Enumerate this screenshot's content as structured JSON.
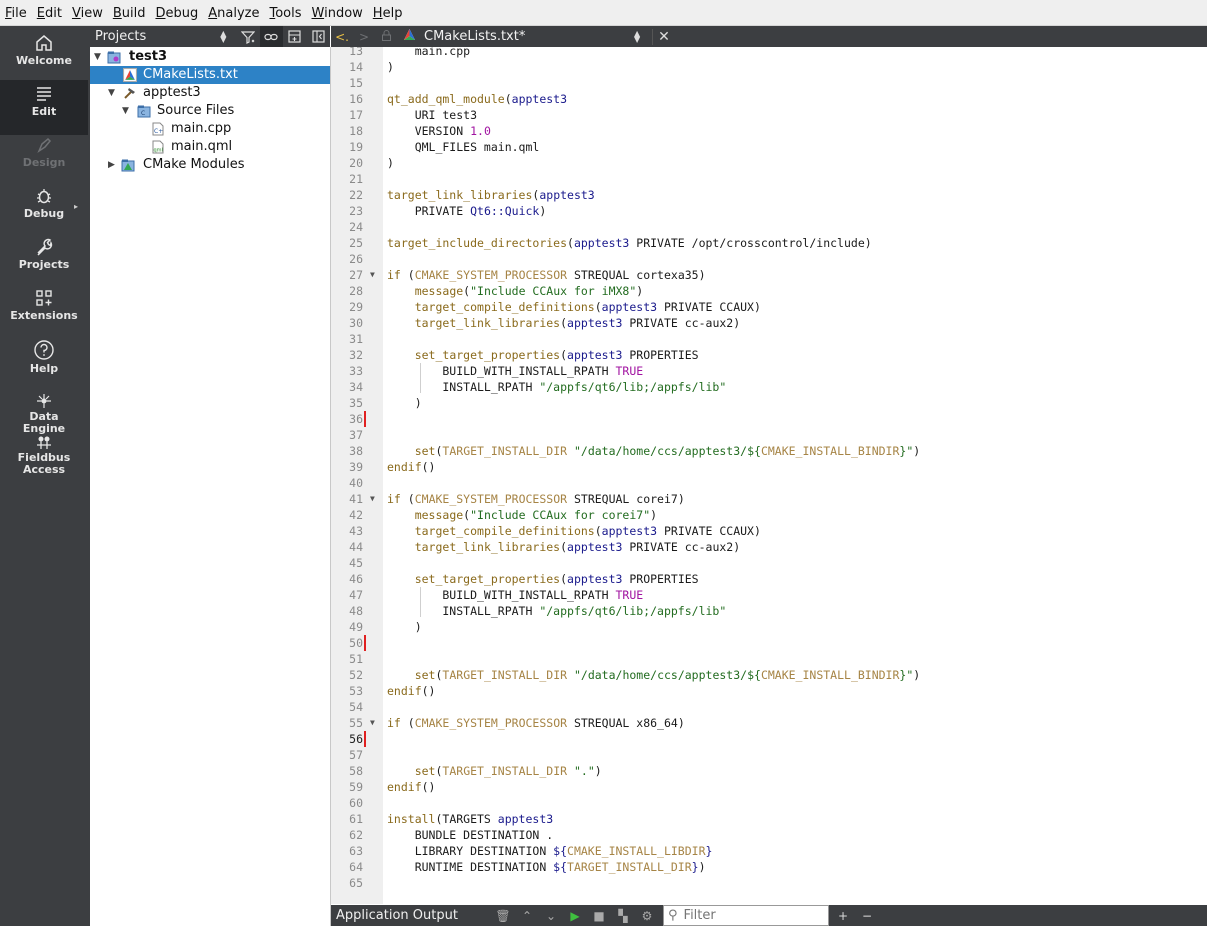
{
  "menu": [
    "File",
    "Edit",
    "View",
    "Build",
    "Debug",
    "Analyze",
    "Tools",
    "Window",
    "Help"
  ],
  "modes": [
    {
      "label": "Welcome",
      "icon": "home-icon"
    },
    {
      "label": "Edit",
      "icon": "edit-icon"
    },
    {
      "label": "Design",
      "icon": "design-icon"
    },
    {
      "label": "Debug",
      "icon": "bug-icon"
    },
    {
      "label": "Projects",
      "icon": "wrench-icon"
    },
    {
      "label": "Extensions",
      "icon": "extensions-icon"
    },
    {
      "label": "Help",
      "icon": "help-icon"
    },
    {
      "label": "Data\nEngine",
      "icon": "data-engine-icon"
    },
    {
      "label": "Fieldbus\nAccess",
      "icon": "fieldbus-icon"
    }
  ],
  "projects_pane": {
    "title": "Projects",
    "tree": [
      {
        "label": "test3",
        "icon": "cmake-project-icon",
        "bold": true,
        "expanded": true
      },
      {
        "label": "CMakeLists.txt",
        "icon": "cmake-file-icon",
        "selected": true
      },
      {
        "label": "apptest3",
        "icon": "hammer-icon",
        "expanded": true
      },
      {
        "label": "Source Files",
        "icon": "source-folder-icon",
        "expanded": true
      },
      {
        "label": "main.cpp",
        "icon": "cpp-file-icon"
      },
      {
        "label": "main.qml",
        "icon": "qml-file-icon"
      },
      {
        "label": "CMake Modules",
        "icon": "cmake-modules-icon",
        "expanded": false
      }
    ]
  },
  "editor": {
    "file_name": "CMakeLists.txt*",
    "current_line": 56,
    "lines": [
      {
        "n": 13,
        "text": "    main.cpp"
      },
      {
        "n": 14,
        "text": ")"
      },
      {
        "n": 15,
        "text": ""
      },
      {
        "n": 16,
        "text": "qt_add_qml_module(apptest3"
      },
      {
        "n": 17,
        "text": "    URI test3"
      },
      {
        "n": 18,
        "text": "    VERSION 1.0"
      },
      {
        "n": 19,
        "text": "    QML_FILES main.qml"
      },
      {
        "n": 20,
        "text": ")"
      },
      {
        "n": 21,
        "text": ""
      },
      {
        "n": 22,
        "text": "target_link_libraries(apptest3"
      },
      {
        "n": 23,
        "text": "    PRIVATE Qt6::Quick)"
      },
      {
        "n": 24,
        "text": ""
      },
      {
        "n": 25,
        "text": "target_include_directories(apptest3 PRIVATE /opt/crosscontrol/include)"
      },
      {
        "n": 26,
        "text": ""
      },
      {
        "n": 27,
        "text": "if (CMAKE_SYSTEM_PROCESSOR STREQUAL cortexa35)"
      },
      {
        "n": 28,
        "text": "    message(\"Include CCAux for iMX8\")"
      },
      {
        "n": 29,
        "text": "    target_compile_definitions(apptest3 PRIVATE CCAUX)"
      },
      {
        "n": 30,
        "text": "    target_link_libraries(apptest3 PRIVATE cc-aux2)"
      },
      {
        "n": 31,
        "text": ""
      },
      {
        "n": 32,
        "text": "    set_target_properties(apptest3 PROPERTIES"
      },
      {
        "n": 33,
        "text": "        BUILD_WITH_INSTALL_RPATH TRUE"
      },
      {
        "n": 34,
        "text": "        INSTALL_RPATH \"/appfs/qt6/lib;/appfs/lib\""
      },
      {
        "n": 35,
        "text": "    )"
      },
      {
        "n": 36,
        "text": ""
      },
      {
        "n": 37,
        "text": ""
      },
      {
        "n": 38,
        "text": "    set(TARGET_INSTALL_DIR \"/data/home/ccs/apptest3/${CMAKE_INSTALL_BINDIR}\")"
      },
      {
        "n": 39,
        "text": "endif()"
      },
      {
        "n": 40,
        "text": ""
      },
      {
        "n": 41,
        "text": "if (CMAKE_SYSTEM_PROCESSOR STREQUAL corei7)"
      },
      {
        "n": 42,
        "text": "    message(\"Include CCAux for corei7\")"
      },
      {
        "n": 43,
        "text": "    target_compile_definitions(apptest3 PRIVATE CCAUX)"
      },
      {
        "n": 44,
        "text": "    target_link_libraries(apptest3 PRIVATE cc-aux2)"
      },
      {
        "n": 45,
        "text": ""
      },
      {
        "n": 46,
        "text": "    set_target_properties(apptest3 PROPERTIES"
      },
      {
        "n": 47,
        "text": "        BUILD_WITH_INSTALL_RPATH TRUE"
      },
      {
        "n": 48,
        "text": "        INSTALL_RPATH \"/appfs/qt6/lib;/appfs/lib\""
      },
      {
        "n": 49,
        "text": "    )"
      },
      {
        "n": 50,
        "text": ""
      },
      {
        "n": 51,
        "text": ""
      },
      {
        "n": 52,
        "text": "    set(TARGET_INSTALL_DIR \"/data/home/ccs/apptest3/${CMAKE_INSTALL_BINDIR}\")"
      },
      {
        "n": 53,
        "text": "endif()"
      },
      {
        "n": 54,
        "text": ""
      },
      {
        "n": 55,
        "text": "if (CMAKE_SYSTEM_PROCESSOR STREQUAL x86_64)"
      },
      {
        "n": 56,
        "text": ""
      },
      {
        "n": 57,
        "text": ""
      },
      {
        "n": 58,
        "text": "    set(TARGET_INSTALL_DIR \".\")"
      },
      {
        "n": 59,
        "text": "endif()"
      },
      {
        "n": 60,
        "text": ""
      },
      {
        "n": 61,
        "text": "install(TARGETS apptest3"
      },
      {
        "n": 62,
        "text": "    BUNDLE DESTINATION ."
      },
      {
        "n": 63,
        "text": "    LIBRARY DESTINATION ${CMAKE_INSTALL_LIBDIR}"
      },
      {
        "n": 64,
        "text": "    RUNTIME DESTINATION ${TARGET_INSTALL_DIR})"
      },
      {
        "n": 65,
        "text": ""
      }
    ],
    "fold_lines": [
      27,
      41,
      55
    ],
    "change_marks": [
      36,
      50,
      56
    ]
  },
  "output_pane": {
    "title": "Application Output",
    "filter_placeholder": "Filter"
  },
  "colors": {
    "function": "#8a6a1c",
    "variable": "#a68445",
    "string": "#236c20",
    "number": "#a114a1",
    "target": "#1a1a8c",
    "selection": "#2d82c6",
    "sidebar": "#3c3e41"
  }
}
